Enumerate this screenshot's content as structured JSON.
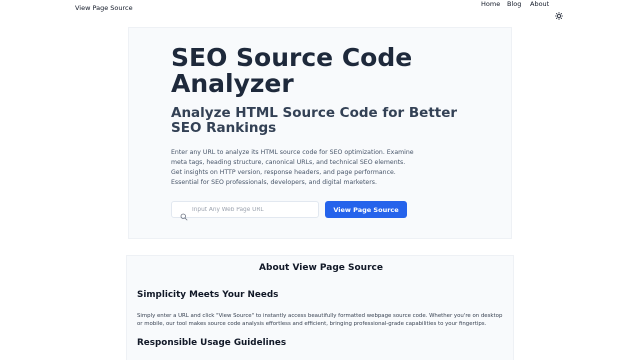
{
  "nav": {
    "brand": "View Page Source",
    "links": [
      "Home",
      "Blog",
      "About"
    ],
    "theme_icon": "sun-icon"
  },
  "hero": {
    "title": "SEO Source Code Analyzer",
    "subtitle": "Analyze HTML Source Code for Better SEO Rankings",
    "description": "Enter any URL to analyze its HTML source code for SEO optimization. Examine meta tags, heading structure, canonical URLs, and technical SEO elements. Get insights on HTTP version, response headers, and page performance. Essential for SEO professionals, developers, and digital marketers.",
    "search": {
      "placeholder": "Input Any Web Page URL",
      "value": "",
      "icon": "search-icon"
    },
    "button_label": "View Page Source"
  },
  "about": {
    "title": "About View Page Source",
    "sections": [
      {
        "heading": "Simplicity Meets Your Needs",
        "text": "Simply enter a URL and click \"View Source\" to instantly access beautifully formatted webpage source code. Whether you're on desktop or mobile, our tool makes source code analysis effortless and efficient, bringing professional-grade capabilities to your fingertips."
      },
      {
        "heading": "Responsible Usage Guidelines",
        "text": ""
      }
    ]
  },
  "colors": {
    "accent": "#2563eb",
    "card_bg": "#f8fafc",
    "title": "#1e293b"
  }
}
